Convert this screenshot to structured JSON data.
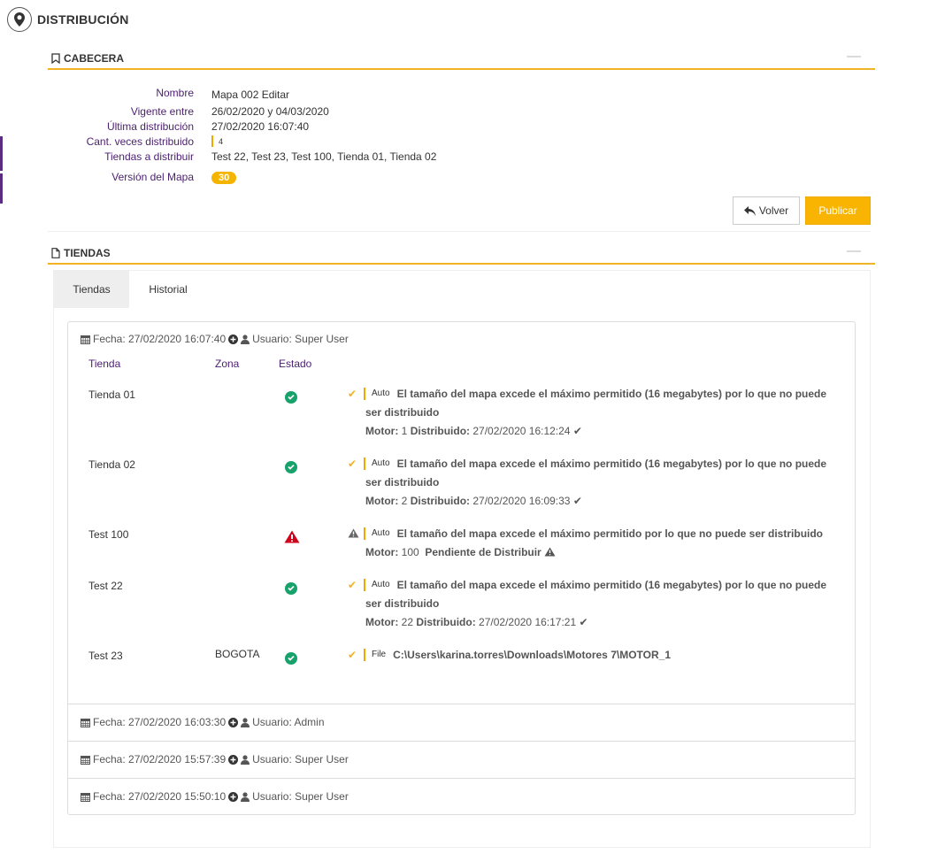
{
  "page": {
    "title": "DISTRIBUCIÓN"
  },
  "cabecera": {
    "title": "CABECERA",
    "collapse": "—",
    "fields": {
      "nombre": {
        "label": "Nombre",
        "value": "Mapa 002 Editar"
      },
      "vigente": {
        "label": "Vigente entre",
        "value": "26/02/2020 y 04/03/2020"
      },
      "ultima": {
        "label": "Última distribución",
        "value": "27/02/2020 16:07:40"
      },
      "cant": {
        "label": "Cant. veces distribuido",
        "value": "4"
      },
      "tiendas": {
        "label": "Tiendas a distribuir",
        "value": "Test 22, Test 23, Test 100, Tienda 01, Tienda 02"
      },
      "version": {
        "label": "Versión del Mapa",
        "value": "30"
      }
    },
    "buttons": {
      "volver": "Volver",
      "publicar": "Publicar"
    }
  },
  "tiendas_section": {
    "title": "TIENDAS",
    "collapse": "—",
    "tabs": [
      "Tiendas",
      "Historial"
    ],
    "columns": {
      "tienda": "Tienda",
      "zona": "Zona",
      "estado": "Estado"
    },
    "groups": [
      {
        "fecha": "Fecha: 27/02/2020 16:07:40",
        "usuario": "Usuario: Super User"
      },
      {
        "fecha": "Fecha: 27/02/2020 16:03:30",
        "usuario": "Usuario: Admin"
      },
      {
        "fecha": "Fecha: 27/02/2020 15:57:39",
        "usuario": "Usuario: Super User"
      },
      {
        "fecha": "Fecha: 27/02/2020 15:50:10",
        "usuario": "Usuario: Super User"
      }
    ],
    "rows": [
      {
        "tienda": "Tienda 01",
        "zona": "",
        "estado": "ok",
        "tag": "Auto",
        "msg": "El tamaño del mapa excede el máximo permitido (16 megabytes) por lo que no puede",
        "msg2": "ser distribuido",
        "motor_label": "Motor:",
        "motor": "1",
        "dist_label": "Distribuido:",
        "dist": "27/02/2020 16:12:24"
      },
      {
        "tienda": "Tienda 02",
        "zona": "",
        "estado": "ok",
        "tag": "Auto",
        "msg": "El tamaño del mapa excede el máximo permitido (16 megabytes) por lo que no puede",
        "msg2": "ser distribuido",
        "motor_label": "Motor:",
        "motor": "2",
        "dist_label": "Distribuido:",
        "dist": "27/02/2020 16:09:33"
      },
      {
        "tienda": "Test 100",
        "zona": "",
        "estado": "warning",
        "tag": "Auto",
        "msg": "El tamaño del mapa excede el máximo permitido por lo que no puede ser distribuido",
        "motor_label": "Motor:",
        "motor": "100",
        "pending": "Pendiente de Distribuir"
      },
      {
        "tienda": "Test 22",
        "zona": "",
        "estado": "ok",
        "tag": "Auto",
        "msg": "El tamaño del mapa excede el máximo permitido (16 megabytes) por lo que no puede",
        "msg2": "ser distribuido",
        "motor_label": "Motor:",
        "motor": "22",
        "dist_label": "Distribuido:",
        "dist": "27/02/2020 16:17:21"
      },
      {
        "tienda": "Test 23",
        "zona": "BOGOTA",
        "estado": "ok",
        "tag": "File",
        "msg": "C:\\Users\\karina.torres\\Downloads\\Motores 7\\MOTOR_1"
      }
    ]
  },
  "colors": {
    "accent": "#f0b323",
    "label": "#4b1f6f",
    "ok": "#17a26b",
    "error": "#d0021b"
  }
}
